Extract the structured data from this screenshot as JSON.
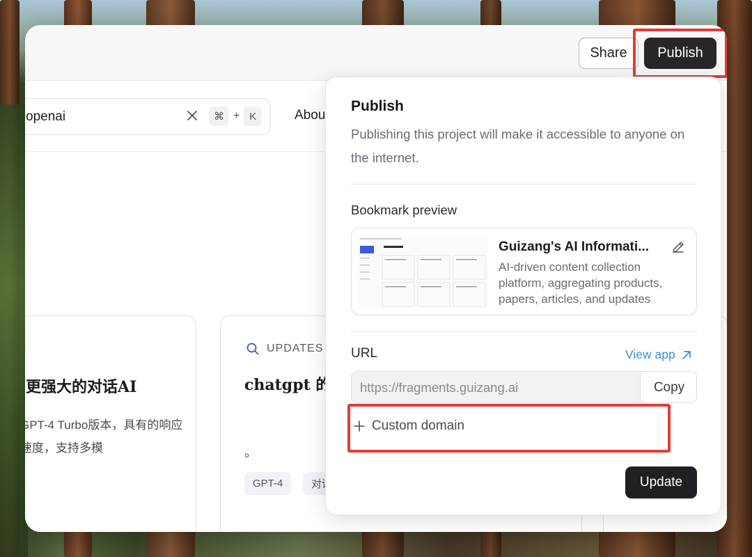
{
  "window": {
    "share_label": "Share",
    "publish_label": "Publish"
  },
  "app": {
    "search_value": "openai",
    "shortcut_cmd": "⌘",
    "shortcut_plus": "+",
    "shortcut_key": "K",
    "nav_about": "About",
    "card1": {
      "title": "更强大的对话AI",
      "desc": "GPT-4 Turbo版本，具有的响应速度，支持多模"
    },
    "card2": {
      "category": "UPDATES",
      "title": "chatgpt 的付费用户提",
      "tail": "。",
      "tags": [
        "GPT-4",
        "对话"
      ]
    }
  },
  "publish_popover": {
    "title": "Publish",
    "description": "Publishing this project will make it accessible to anyone on the internet.",
    "bookmark_label": "Bookmark preview",
    "bookmark": {
      "title": "Guizang's AI Informati...",
      "description": "AI-driven content collection platform, aggregating products, papers, articles, and updates"
    },
    "url_label": "URL",
    "view_app_label": "View app",
    "url_value": "https://fragments.guizang.ai",
    "copy_label": "Copy",
    "custom_domain_label": "Custom domain",
    "update_label": "Update"
  },
  "colors": {
    "highlight": "#e33b3b",
    "link": "#3b8fd9",
    "dark_button": "#27272a"
  },
  "icons": [
    "close-icon",
    "search-icon",
    "pencil-icon",
    "arrow-up-right-icon",
    "plus-icon"
  ]
}
